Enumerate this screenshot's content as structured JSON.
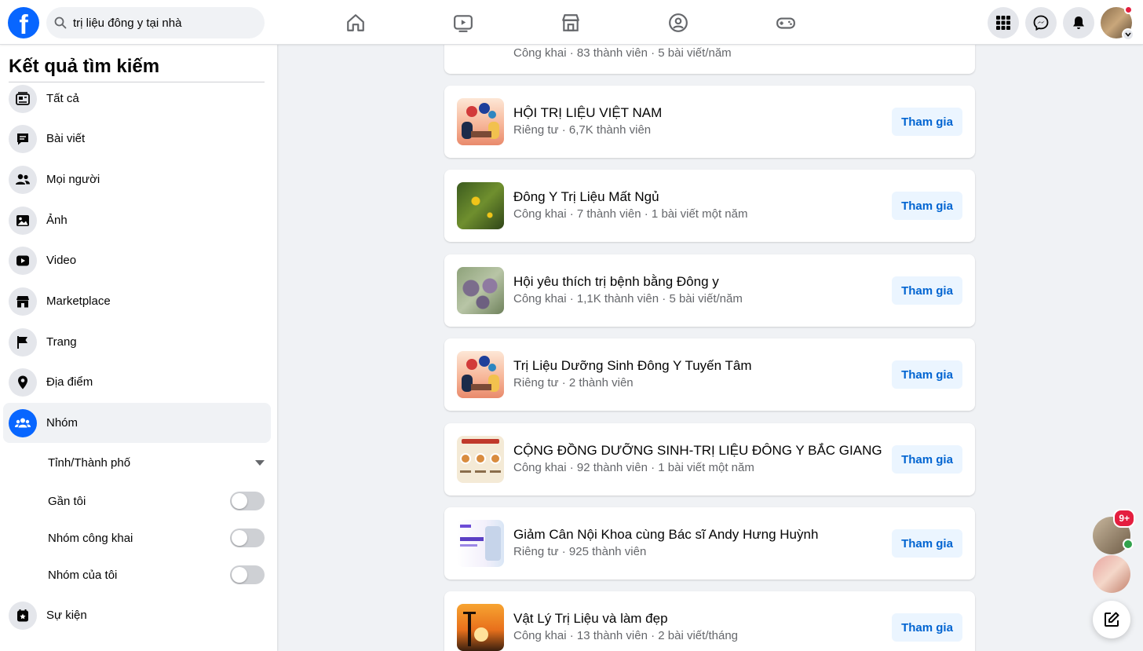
{
  "search": {
    "query": "trị liệu đông y tại nhà"
  },
  "nav": [
    "home-icon",
    "watch-icon",
    "marketplace-icon",
    "groups-icon",
    "gaming-icon"
  ],
  "sidebar": {
    "title": "Kết quả tìm kiếm",
    "items": [
      {
        "label": "Tất cả",
        "icon": "all-results-icon"
      },
      {
        "label": "Bài viết",
        "icon": "posts-icon"
      },
      {
        "label": "Mọi người",
        "icon": "people-icon"
      },
      {
        "label": "Ảnh",
        "icon": "photos-icon"
      },
      {
        "label": "Video",
        "icon": "video-icon"
      },
      {
        "label": "Marketplace",
        "icon": "marketplace-icon"
      },
      {
        "label": "Trang",
        "icon": "pages-flag-icon"
      },
      {
        "label": "Địa điểm",
        "icon": "location-pin-icon"
      },
      {
        "label": "Nhóm",
        "icon": "groups-icon",
        "active": true
      },
      {
        "label": "Sự kiện",
        "icon": "events-icon"
      }
    ],
    "filters": {
      "city": "Tỉnh/Thành phố",
      "near_me": "Gần tôi",
      "public_groups": "Nhóm công khai",
      "my_groups": "Nhóm của tôi"
    }
  },
  "results": {
    "top_partial": {
      "meta": "Công khai · 83 thành viên · 5 bài viết/năm"
    },
    "join_label": "Tham gia",
    "groups": [
      {
        "name": "HỘI TRỊ LIỆU VIỆT NAM",
        "meta": "Riêng tư · 6,7K thành viên"
      },
      {
        "name": "Đông Y Trị Liệu Mất Ngủ",
        "meta": "Công khai · 7 thành viên · 1 bài viết một năm"
      },
      {
        "name": "Hội yêu thích trị bệnh bằng Đông y",
        "meta": "Công khai · 1,1K thành viên · 5 bài viết/năm"
      },
      {
        "name": "Trị Liệu Dưỡng Sinh Đông Y Tuyến Tâm",
        "meta": "Riêng tư · 2 thành viên"
      },
      {
        "name": "CỘNG ĐỒNG DƯỠNG SINH-TRỊ LIỆU ĐÔNG Y BẮC GIANG",
        "meta": "Công khai · 92 thành viên · 1 bài viết một năm"
      },
      {
        "name": "Giảm Cân Nội Khoa cùng Bác sĩ Andy Hưng Huỳnh",
        "meta": "Riêng tư · 925 thành viên"
      },
      {
        "name": "Vật Lý Trị Liệu và làm đẹp",
        "meta": "Công khai · 13 thành viên · 2 bài viết/tháng"
      }
    ]
  },
  "chat": {
    "badge": "9+"
  },
  "colors": {
    "brand": "#0866ff",
    "join_bg": "#ebf5ff",
    "join_text": "#0064d1",
    "page_bg": "#f0f2f5"
  }
}
